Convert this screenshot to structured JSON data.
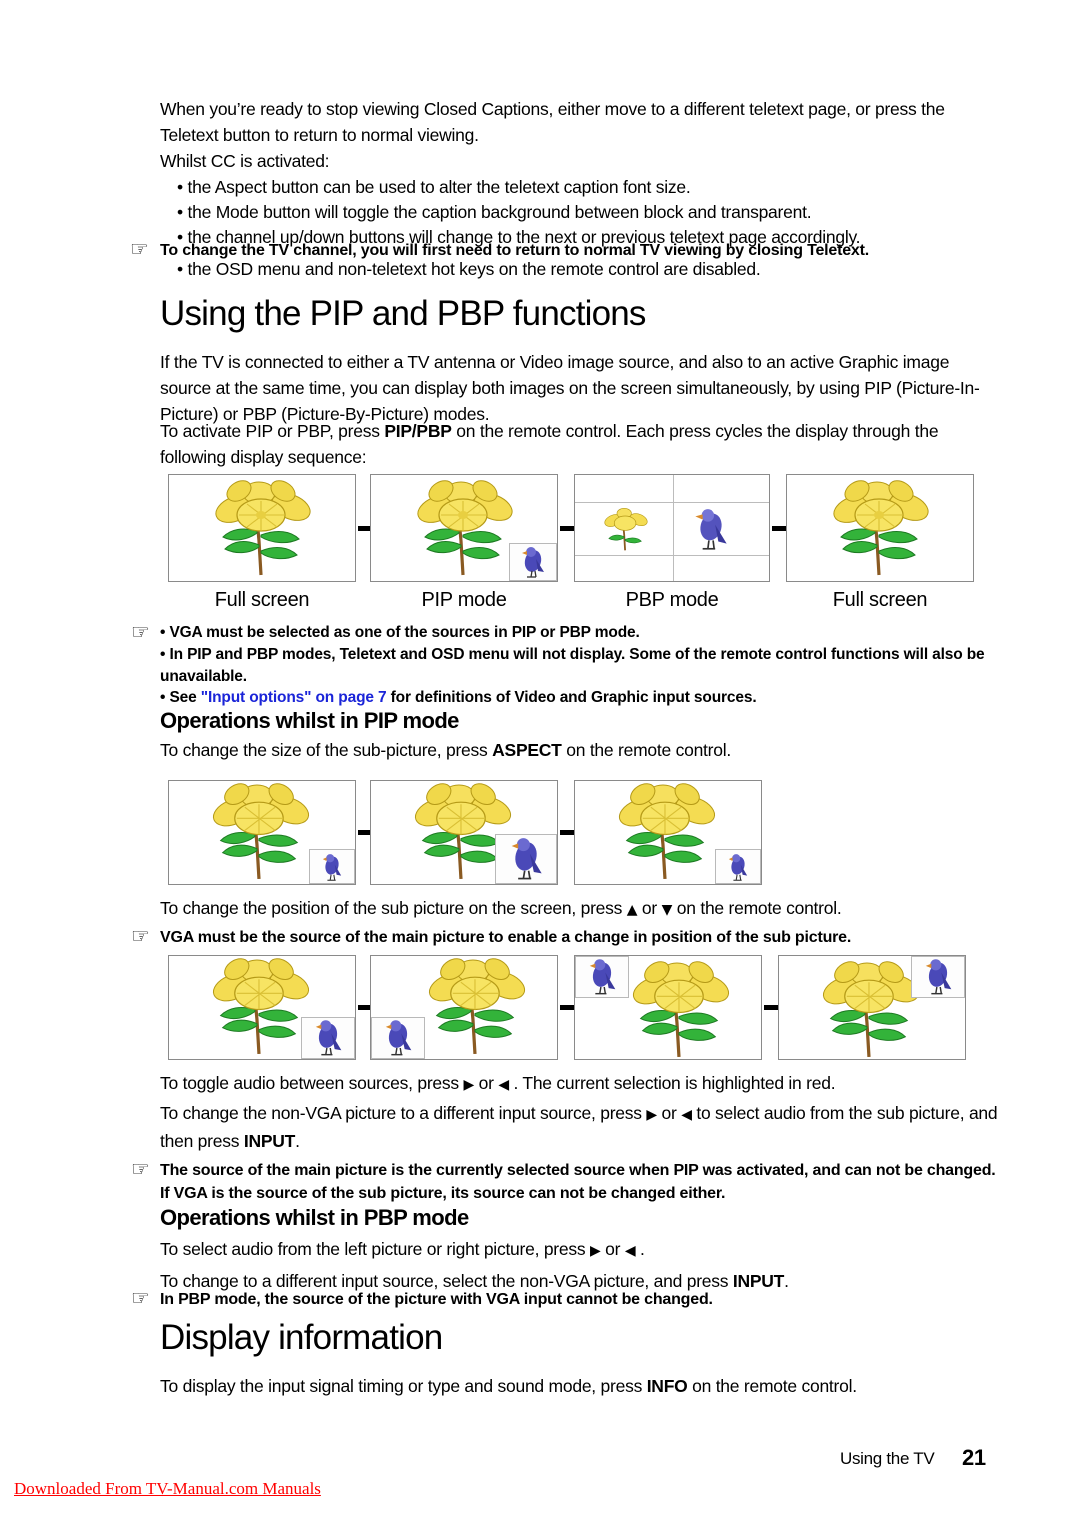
{
  "document": {
    "intro": {
      "para1": "When you’re ready to stop viewing Closed Captions, either move to a different teletext page, or press the Teletext button to return to normal viewing.",
      "para2": "Whilst CC is activated:",
      "bullets": [
        "the Aspect button can be used to alter the teletext caption font size.",
        "the Mode button will toggle the caption background between block and transparent.",
        "the channel up/down buttons will change to the next or previous teletext page accordingly."
      ],
      "note": "To change the TV channel, you will first need to return to normal TV viewing by closing Teletext.",
      "bullet_after_note": "the OSD menu and non-teletext hot keys on the remote control are disabled."
    },
    "section_pip": {
      "heading": "Using the PIP and PBP functions",
      "para1": "If the TV is connected to either a TV antenna or Video image source, and also to an active Graphic image source at the same time, you can display both images on the screen simultaneously, by using PIP (Picture-In-Picture) or PBP (Picture-By-Picture) modes.",
      "para2_a": "To activate PIP or PBP, press ",
      "para2_b": "PIP/PBP",
      "para2_c": " on the remote control. Each press cycles the display through the following display sequence:",
      "sequence_captions": [
        "Full screen",
        "PIP mode",
        "PBP mode",
        "Full screen"
      ],
      "notes": [
        "VGA must be selected as one of the sources in PIP or PBP mode.",
        "In PIP and PBP modes, Teletext and OSD menu will not display. Some of the remote control functions will also be unavailable."
      ],
      "note_link_prefix": "See ",
      "note_link_text": "\"Input options\" on page 7",
      "note_link_suffix": " for definitions of Video and Graphic input sources.",
      "link_color": "#1a24d8"
    },
    "section_pip_ops": {
      "heading": "Operations whilst in PIP mode",
      "para_size_a": "To change the size of the sub-picture, press ",
      "para_size_b": "ASPECT",
      "para_size_c": "  on the remote control.",
      "para_position_a": "To change the position of the sub picture on the screen, press ",
      "para_position_up": "▲",
      "para_position_mid": " or ",
      "para_position_down": "▼",
      "para_position_b": " on the remote control.",
      "note_position": "VGA must be the source of the main picture to enable a change in position of the sub picture.",
      "para_audio_a": "To toggle audio between sources, press ",
      "para_audio_right": "▶",
      "para_audio_mid": " or ",
      "para_audio_left": "◀",
      "para_audio_b": " . The current selection is highlighted in red.",
      "para_input_a": "To change the non-VGA picture to a different input source, press ",
      "para_input_right": "▶",
      "para_input_mid": " or ",
      "para_input_left": "◀",
      "para_input_b": " to select audio from the sub picture, and then press ",
      "para_input_c": "INPUT",
      "para_input_d": ".",
      "note_source": "The source of the main picture is the currently selected source when PIP was activated, and can not be changed. If VGA is the source of the sub picture, its source can not be changed either."
    },
    "section_pbp_ops": {
      "heading": "Operations whilst in PBP mode",
      "para_audio_a": "To select audio from the left picture or right picture, press ",
      "para_audio_right": "▶",
      "para_audio_mid": " or ",
      "para_audio_left": "◀",
      "para_audio_b": " .",
      "para_input_a": "To change to a different input source, select the non-VGA picture, and press ",
      "para_input_b": "INPUT",
      "para_input_c": ".",
      "note": "In PBP mode, the source of the picture with VGA input cannot be changed."
    },
    "section_display": {
      "heading": "Display information",
      "para_a": "To display the input signal timing or type and sound mode, press ",
      "para_b": "INFO",
      "para_c": " on the remote control."
    },
    "footer": {
      "section_label": "Using the TV",
      "page_number": "21",
      "watermark": "Downloaded From TV-Manual.com Manuals",
      "watermark_color": "#ff0000"
    },
    "icons": {
      "hand": "☞",
      "bullet": "•"
    }
  }
}
